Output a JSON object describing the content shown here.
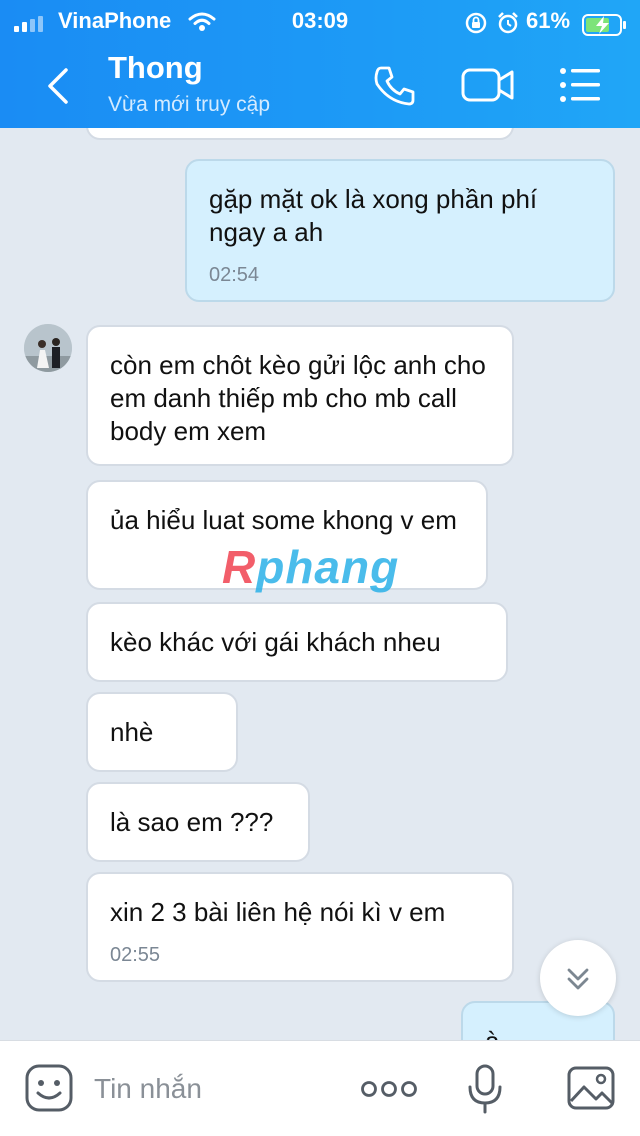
{
  "status_bar": {
    "carrier": "VinaPhone",
    "time": "03:09",
    "battery": "61%"
  },
  "header": {
    "title": "Thong",
    "subtitle": "Vừa mới truy cập",
    "accent_color": "#1a8cf4"
  },
  "messages": [
    {
      "side": "me",
      "text": "gặp mặt ok là xong phần phí ngay a ah",
      "time": "02:54"
    },
    {
      "side": "them",
      "text": "còn em chôt kèo gửi lộc anh cho em danh thiếp mb cho mb call body em xem",
      "time": ""
    },
    {
      "side": "them",
      "text": "ủa hiểu luat some khong v em",
      "time": ""
    },
    {
      "side": "them",
      "text": "kèo khác với gái khách nheu",
      "time": ""
    },
    {
      "side": "them",
      "text": "nhè",
      "time": ""
    },
    {
      "side": "them",
      "text": "là sao em ???",
      "time": ""
    },
    {
      "side": "them",
      "text": "xin 2 3 bài liên hệ nói kì v em",
      "time": "02:55"
    },
    {
      "side": "me",
      "text": "à",
      "time": ""
    }
  ],
  "watermark": {
    "first": "R",
    "rest": "phang"
  },
  "input": {
    "placeholder": "Tin nhắn"
  },
  "icons": [
    "back-icon",
    "phone-icon",
    "video-icon",
    "menu-icon",
    "chevron-down-icon",
    "emoji-icon",
    "more-icon",
    "mic-icon",
    "image-icon"
  ]
}
